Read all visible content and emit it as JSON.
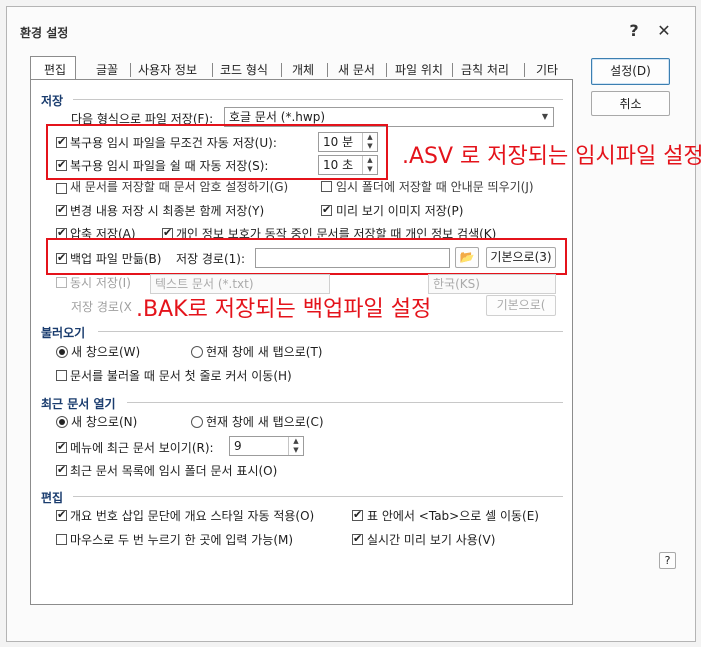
{
  "window": {
    "title": "환경 설정",
    "help_btn": "?",
    "close_btn": "✕"
  },
  "tabs": [
    "편집",
    "글꼴",
    "사용자 정보",
    "코드 형식",
    "개체",
    "새 문서",
    "파일 위치",
    "금칙 처리",
    "기타"
  ],
  "buttons": {
    "ok": "설정(D)",
    "cancel": "취소",
    "folder": "📂",
    "default_backup": "기본으로(3)",
    "default_disabled": "기본으로(",
    "help_bottom": "?"
  },
  "save": {
    "section": "저장",
    "format_label": "다음 형식으로 파일 저장(F):",
    "format_value": "호글 문서 (*.hwp)",
    "auto_always_label": "복구용 임시 파일을 무조건 자동 저장(U):",
    "auto_always_value": "10 분",
    "auto_idle_label": "복구용 임시 파일을 쉴 때 자동 저장(S):",
    "auto_idle_value": "10 초",
    "new_doc_pw_label": "새 문서를 저장할 때 문서 암호 설정하기(G)",
    "temp_folder_label": "임시 폴더에 저장할 때 안내문 띄우기(J)",
    "final_label": "변경 내용 저장 시 최종본 함께 저장(Y)",
    "preview_label": "미리 보기 이미지 저장(P)",
    "compress_label": "압축 저장(A)",
    "privacy_label": "개인 정보 보호가 동작 중인 문서를 저장할 때 개인 정보 검색(K)",
    "backup_label": "백업 파일 만듦(B)",
    "backup_path_label": "저장 경로(1):",
    "backup_path_value": "",
    "also_save_label": "동시 저장(I)",
    "also_save_format": "텍스트 문서 (*.txt)",
    "also_save_encoding": "한국(KS)",
    "also_path_label": "저장 경로(X"
  },
  "open": {
    "section": "불러오기",
    "new_window": "새 창으로(W)",
    "new_tab": "현재 창에 새 탭으로(T)",
    "move_first": "문서를 불러올 때 문서 첫 줄로 커서 이동(H)"
  },
  "recent": {
    "section": "최근 문서 열기",
    "new_window": "새 창으로(N)",
    "new_tab": "현재 창에 새 탭으로(C)",
    "show_menu": "메뉴에 최근 문서 보이기(R):",
    "count": "9",
    "show_temp": "최근 문서 목록에 임시 폴더 문서 표시(O)"
  },
  "edit": {
    "section": "편집",
    "auto_style": "개요 번호 삽입 문단에 개요 스타일 자동 적용(O)",
    "tab_move": "표 안에서 <Tab>으로 셀 이동(E)",
    "dblclick": "마우스로 두 번 누르기 한 곳에 입력 가능(M)",
    "live_preview": "실시간 미리 보기 사용(V)"
  },
  "annotations": {
    "asv": ".ASV 로 저장되는 임시파일 설정",
    "bak": ".BAK로 저장되는 백업파일 설정"
  },
  "colors": {
    "annotation": "#e4131b",
    "section": "#1a3c6e"
  }
}
